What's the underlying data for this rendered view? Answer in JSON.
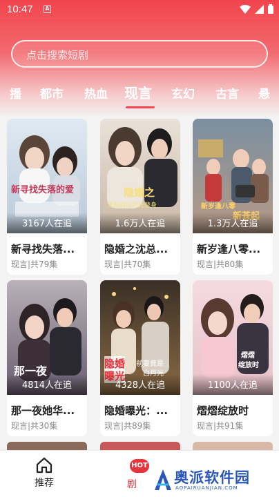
{
  "status": {
    "time": "10:47",
    "notif_glyph": "A"
  },
  "search": {
    "placeholder": "点击搜索短剧"
  },
  "tabs": [
    {
      "label": "播"
    },
    {
      "label": "都市"
    },
    {
      "label": "热血"
    },
    {
      "label": "现言",
      "active": true
    },
    {
      "label": "玄幻"
    },
    {
      "label": "古言"
    },
    {
      "label": "悬"
    }
  ],
  "cards": [
    {
      "title": "新寻找失落...",
      "meta": "现言|共79集",
      "views": "3167人在追"
    },
    {
      "title": "隐婚之沈总...",
      "meta": "现言|共70集",
      "views": "1.6万人在追"
    },
    {
      "title": "新岁逢八零...",
      "meta": "现言|共80集",
      "views": "1.3万人在追"
    },
    {
      "title": "那一夜她华...",
      "meta": "现言|共30集",
      "views": "4814人在追"
    },
    {
      "title": "隐婚曝光：...",
      "meta": "现言|共89集",
      "views": "4328人在追"
    },
    {
      "title": "熠熠绽放时",
      "meta": "现言|共91集",
      "views": "1100人在追"
    }
  ],
  "poster_text": {
    "p1": "新寻找失落的爱",
    "p2a": "隐婚之",
    "p2b": "沈总的白月光替身",
    "p3a": "新岁逢八零",
    "p3b": "新苍起",
    "p4": "那一夜",
    "p5a": "隐婚",
    "p5b": "曝光",
    "p5c": "前妻竟是",
    "p5d": "白月光",
    "p6a": "熠熠",
    "p6b": "绽放时"
  },
  "nav": {
    "home": "推荐",
    "drama": "剧",
    "hot_badge": "HOT"
  },
  "watermark": {
    "text": "奥派软件园",
    "sub": "AOPAIRUANJIAN.COM"
  },
  "colors": {
    "accent": "#f04a50",
    "header": "#f2444d"
  }
}
